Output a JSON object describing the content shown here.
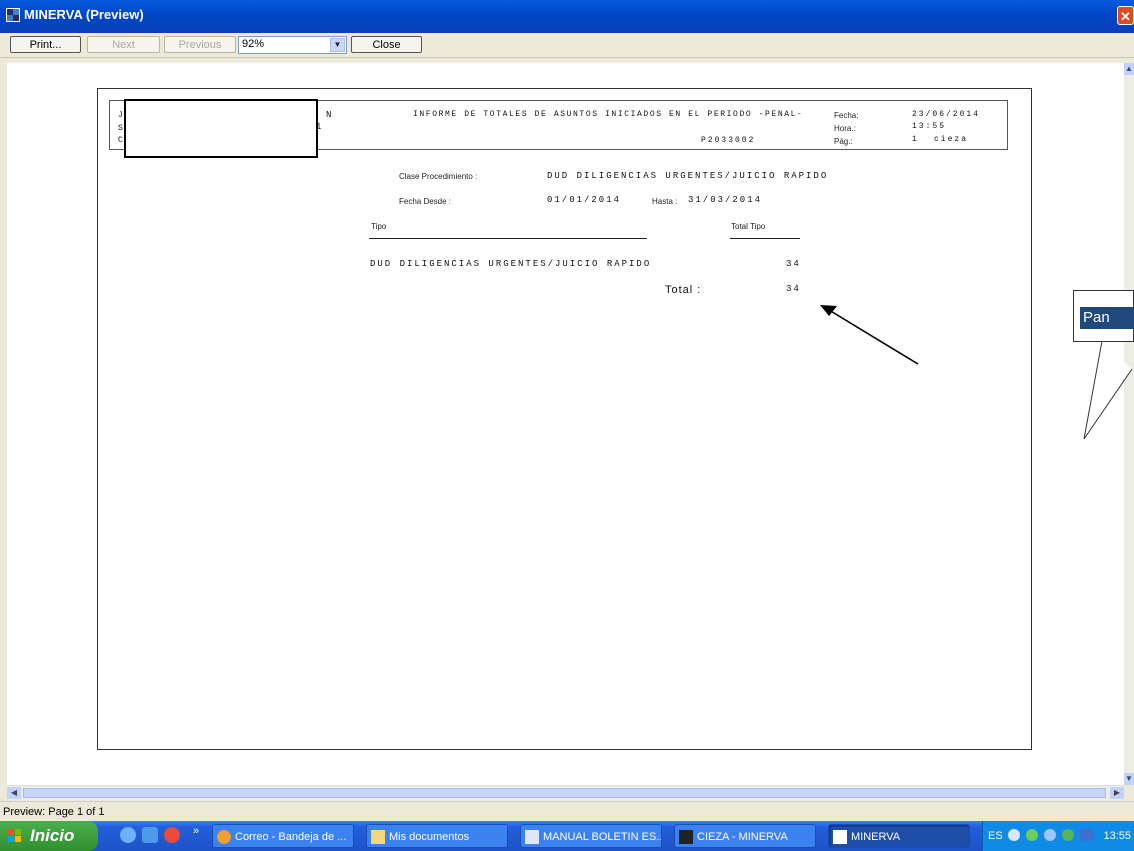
{
  "window": {
    "title": "MINERVA (Preview)",
    "close_glyph": "✕"
  },
  "toolbar": {
    "print_label": "Print...",
    "next_label": "Next",
    "previous_label": "Previous",
    "zoom_value": "92%",
    "close_label": "Close"
  },
  "report": {
    "header_title": "INFORME DE TOTALES DE ASUNTOS INICIADOS EN EL PERIODO -PENAL-",
    "header_code": "P2033002",
    "fecha_label": "Fecha:",
    "fecha_value": "23/06/2014",
    "hora_label": "Hora.:",
    "hora_value": "13:55",
    "pag_label": "Pág.:",
    "pag_value": "1",
    "place": "cieza",
    "left_fragment_1": "N",
    "left_fragment_2": "1",
    "left_edge_1": "J",
    "left_edge_2": "S",
    "left_edge_3": "C",
    "clase_label": "Clase Procedimiento :",
    "clase_value": "DUD DILIGENCIAS URGENTES/JUICIO RAPIDO",
    "fecha_desde_label": "Fecha Desde :",
    "fecha_desde_value": "01/01/2014",
    "hasta_label": "Hasta :",
    "hasta_value": "31/03/2014",
    "col_tipo": "Tipo",
    "col_total_tipo": "Total Tipo",
    "rows": [
      {
        "tipo": "DUD DILIGENCIAS URGENTES/JUICIO RAPIDO",
        "total": "34"
      }
    ],
    "total_label": "Total :",
    "total_value": "34"
  },
  "annotation": {
    "callout_text": "Pan"
  },
  "status": {
    "text": "Preview: Page 1 of 1"
  },
  "taskbar": {
    "start_label": "Inicio",
    "chevron": "»",
    "tasks": [
      {
        "label": "Correo - Bandeja de ..."
      },
      {
        "label": "Mis documentos"
      },
      {
        "label": "MANUAL BOLETIN ES..."
      },
      {
        "label": "CIEZA - MINERVA"
      },
      {
        "label": "MINERVA"
      }
    ],
    "language": "ES",
    "clock": "13:55"
  }
}
